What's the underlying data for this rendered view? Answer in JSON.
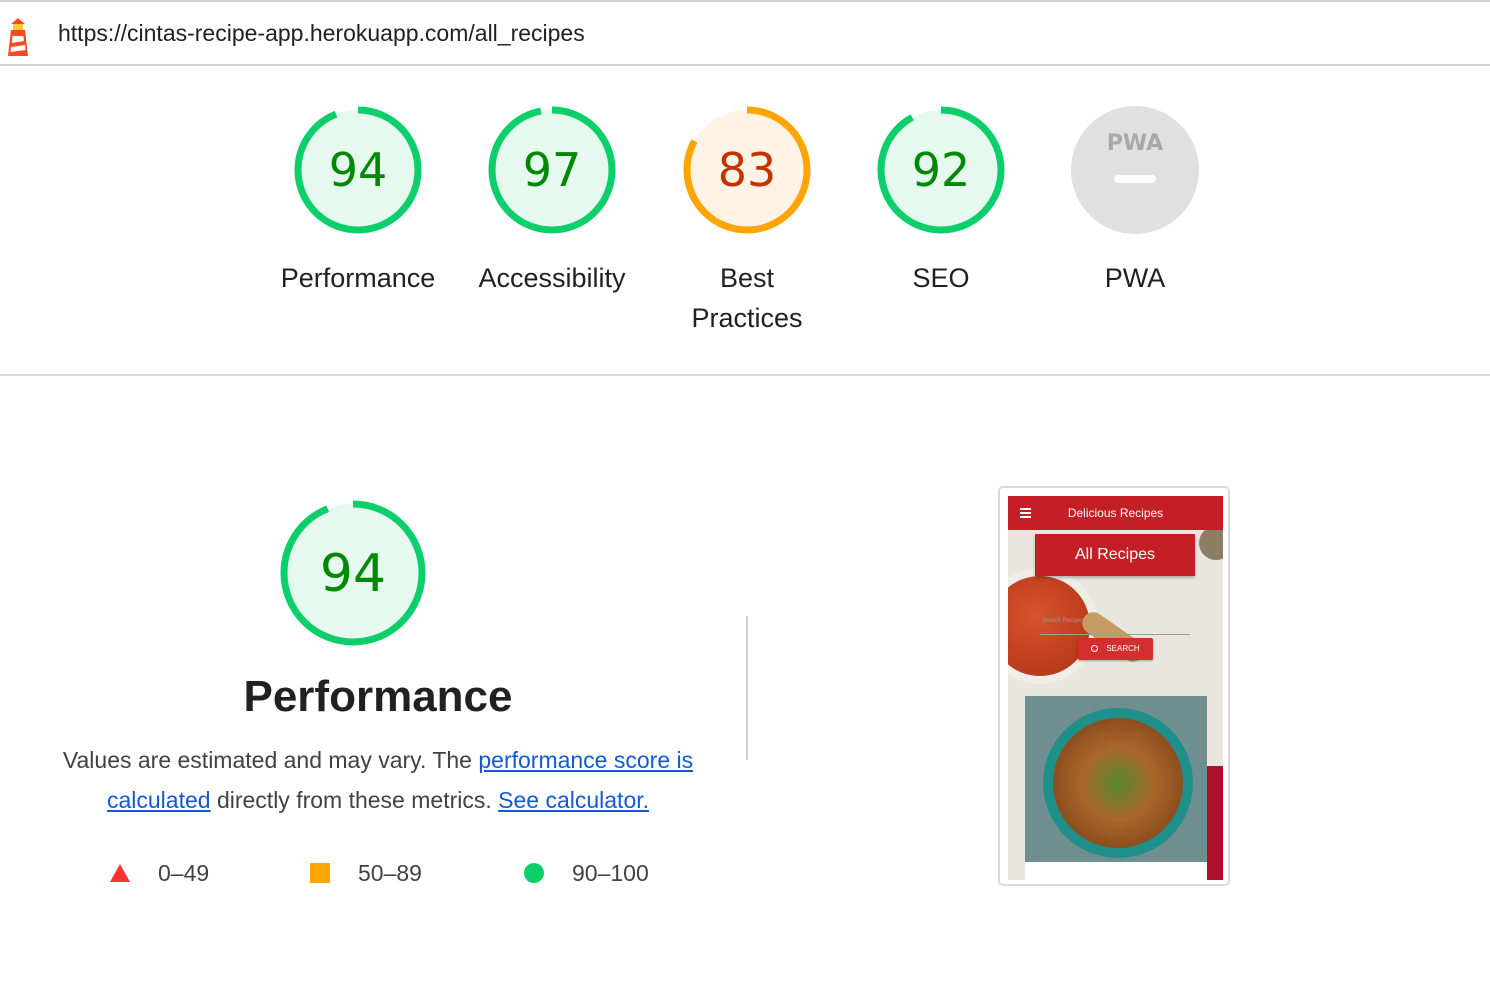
{
  "address_bar": {
    "url": "https://cintas-recipe-app.herokuapp.com/all_recipes",
    "icon": "lighthouse-icon"
  },
  "categories": [
    {
      "id": "performance",
      "score": "94",
      "label": "Performance",
      "rating": "pass"
    },
    {
      "id": "accessibility",
      "score": "97",
      "label": "Accessibility",
      "rating": "pass"
    },
    {
      "id": "best-practices",
      "score": "83",
      "label": "Best Practices",
      "rating": "average"
    },
    {
      "id": "seo",
      "score": "92",
      "label": "SEO",
      "rating": "pass"
    },
    {
      "id": "pwa",
      "score": "",
      "label": "PWA",
      "rating": "na",
      "badge": "PWA"
    }
  ],
  "colors": {
    "pass": "#0cce6b",
    "pass_fill": "#e6f9ef",
    "pass_text": "#008800",
    "average": "#ffa400",
    "average_fill": "#fff3e6",
    "average_text": "#c33300",
    "fail": "#ff3333",
    "na_fill": "#e0e0e0",
    "link": "#1558d6"
  },
  "performance": {
    "score": "94",
    "title": "Performance",
    "desc_pre": "Values are estimated and may vary. The ",
    "link_score": "performance score is calculated",
    "desc_mid": " directly from these metrics. ",
    "link_calc": "See calculator.",
    "legend": [
      {
        "shape": "triangle",
        "range": "0–49"
      },
      {
        "shape": "square",
        "range": "50–89"
      },
      {
        "shape": "circle",
        "range": "90–100"
      }
    ]
  },
  "screenshot": {
    "header_title": "Delicious Recipes",
    "banner": "All Recipes",
    "search_placeholder": "Search Recipes",
    "search_button": "SEARCH"
  }
}
